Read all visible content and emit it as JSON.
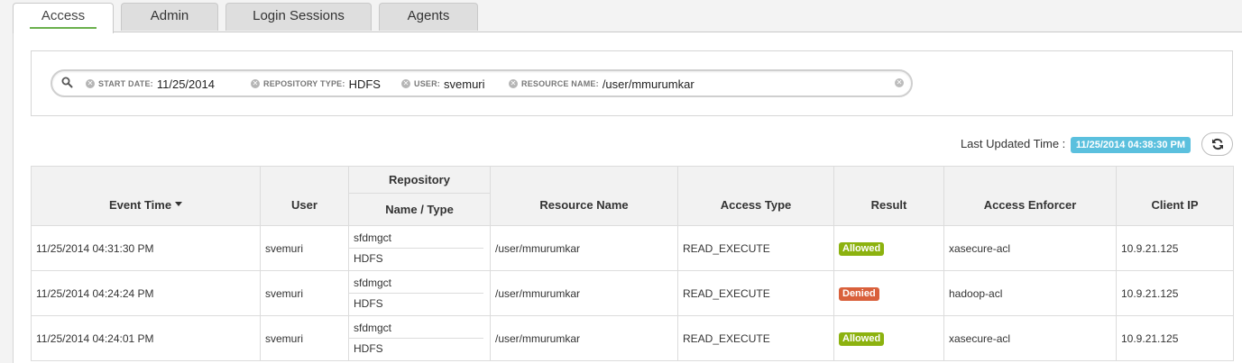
{
  "tabs": [
    {
      "label": "Access",
      "active": true
    },
    {
      "label": "Admin",
      "active": false
    },
    {
      "label": "Login Sessions",
      "active": false
    },
    {
      "label": "Agents",
      "active": false
    }
  ],
  "search": {
    "facets": [
      {
        "category": "START DATE:",
        "value": "11/25/2014"
      },
      {
        "category": "REPOSITORY TYPE:",
        "value": "HDFS"
      },
      {
        "category": "USER:",
        "value": "svemuri"
      },
      {
        "category": "RESOURCE NAME:",
        "value": "/user/mmurumkar"
      }
    ]
  },
  "last_updated": {
    "label": "Last Updated Time :",
    "value": "11/25/2014 04:38:30 PM"
  },
  "table": {
    "headers": {
      "event_time": "Event Time",
      "user": "User",
      "repository": "Repository",
      "name_type": "Name / Type",
      "resource_name": "Resource Name",
      "access_type": "Access Type",
      "result": "Result",
      "access_enforcer": "Access Enforcer",
      "client_ip": "Client IP"
    },
    "rows": [
      {
        "event_time": "11/25/2014 04:31:30 PM",
        "user": "svemuri",
        "repo_name": "sfdmgct",
        "repo_type": "HDFS",
        "resource": "/user/mmurumkar",
        "access_type": "READ_EXECUTE",
        "result": "Allowed",
        "enforcer": "xasecure-acl",
        "client_ip": "10.9.21.125"
      },
      {
        "event_time": "11/25/2014 04:24:24 PM",
        "user": "svemuri",
        "repo_name": "sfdmgct",
        "repo_type": "HDFS",
        "resource": "/user/mmurumkar",
        "access_type": "READ_EXECUTE",
        "result": "Denied",
        "enforcer": "hadoop-acl",
        "client_ip": "10.9.21.125"
      },
      {
        "event_time": "11/25/2014 04:24:01 PM",
        "user": "svemuri",
        "repo_name": "sfdmgct",
        "repo_type": "HDFS",
        "resource": "/user/mmurumkar",
        "access_type": "READ_EXECUTE",
        "result": "Allowed",
        "enforcer": "xasecure-acl",
        "client_ip": "10.9.21.125"
      }
    ]
  },
  "colors": {
    "allowed": "#8cb20f",
    "denied": "#d9603b",
    "badge_info": "#5bc0de",
    "tab_underline": "#6ab04c"
  }
}
